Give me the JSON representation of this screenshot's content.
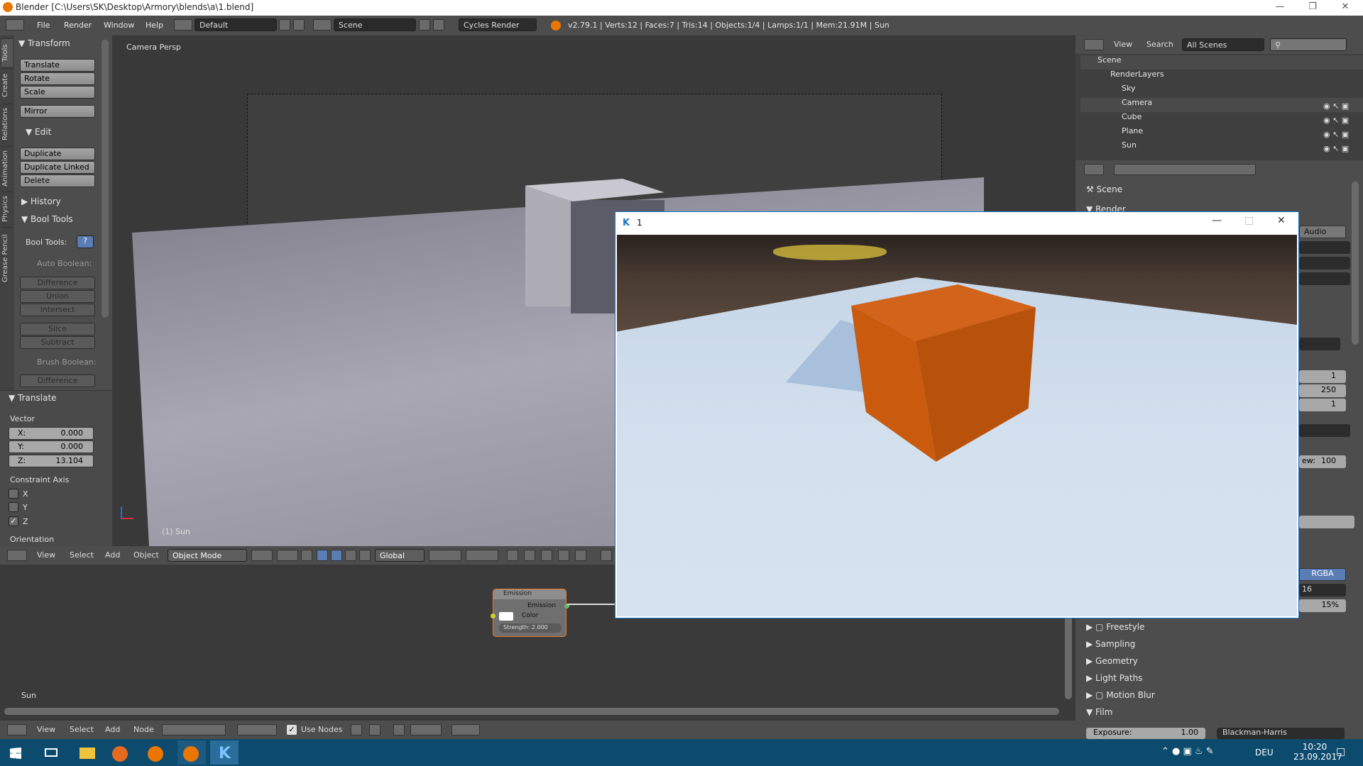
{
  "window_title": "Blender [C:\\Users\\SK\\Desktop\\Armory\\blends\\a\\1.blend]",
  "info": {
    "menus": [
      "File",
      "Render",
      "Window",
      "Help"
    ],
    "layout": "Default",
    "scene": "Scene",
    "engine": "Cycles Render",
    "stats": "v2.79.1 | Verts:12 | Faces:7 | Tris:14 | Objects:1/4 | Lamps:1/1 | Mem:21.91M | Sun"
  },
  "tool_tabs": [
    "Tools",
    "Create",
    "Relations",
    "Animation",
    "Physics",
    "Grease Pencil"
  ],
  "toolshelf": {
    "transform_hdr": "Transform",
    "transform": [
      "Translate",
      "Rotate",
      "Scale"
    ],
    "mirror": "Mirror",
    "edit_hdr": "Edit",
    "edit": [
      "Duplicate",
      "Duplicate Linked",
      "Delete"
    ],
    "history_hdr": "History",
    "bool_hdr": "Bool Tools",
    "bool_tools_label": "Bool Tools:",
    "auto_boolean": "Auto Boolean:",
    "auto_ops": [
      "Difference",
      "Union",
      "Intersect",
      "Slice",
      "Subtract"
    ],
    "brush_boolean": "Brush Boolean:",
    "brush_ops": [
      "Difference"
    ]
  },
  "operator": {
    "hdr": "Translate",
    "vector_label": "Vector",
    "x_label": "X:",
    "x": "0.000",
    "y_label": "Y:",
    "y": "0.000",
    "z_label": "Z:",
    "z": "13.104",
    "constraint_label": "Constraint Axis",
    "axes": [
      "X",
      "Y",
      "Z"
    ],
    "orientation": "Orientation"
  },
  "viewport": {
    "label": "Camera Persp",
    "object": "(1) Sun"
  },
  "view3d_header": {
    "menus": [
      "View",
      "Select",
      "Add",
      "Object"
    ],
    "mode": "Object Mode",
    "orientation": "Global"
  },
  "node_editor": {
    "label": "Sun",
    "node_title": "Emission",
    "out": "Emission",
    "color": "Color",
    "strength": "Strength:",
    "strength_val": "2.000"
  },
  "node_header": {
    "menus": [
      "View",
      "Select",
      "Add",
      "Node"
    ],
    "use_nodes": "Use Nodes"
  },
  "outliner": {
    "menus": [
      "View",
      "Search"
    ],
    "scenes": "All Scenes",
    "items": [
      "Scene",
      "RenderLayers",
      "Sky",
      "Camera",
      "Cube",
      "Plane",
      "Sun"
    ]
  },
  "properties": {
    "scene": "Scene",
    "render_hdr": "Render",
    "audio": "Audio",
    "vals": [
      "1",
      "250",
      "1"
    ],
    "percent_label": "ew:",
    "percent": "100",
    "rgba": "RGBA",
    "sixteen": "16",
    "fifteen": "15%",
    "panels": [
      "Freestyle",
      "Sampling",
      "Geometry",
      "Light Paths",
      "Motion Blur",
      "Film"
    ],
    "exposure": "Exposure:",
    "exposure_val": "1.00",
    "filter": "Blackman-Harris"
  },
  "player_window": {
    "title": "1"
  },
  "taskbar": {
    "lang": "DEU",
    "time": "10:20",
    "date": "23.09.2017"
  },
  "colors": {
    "cube": "#c95a0e",
    "accent": "#1976c9",
    "node_border": "#e67a2d"
  }
}
